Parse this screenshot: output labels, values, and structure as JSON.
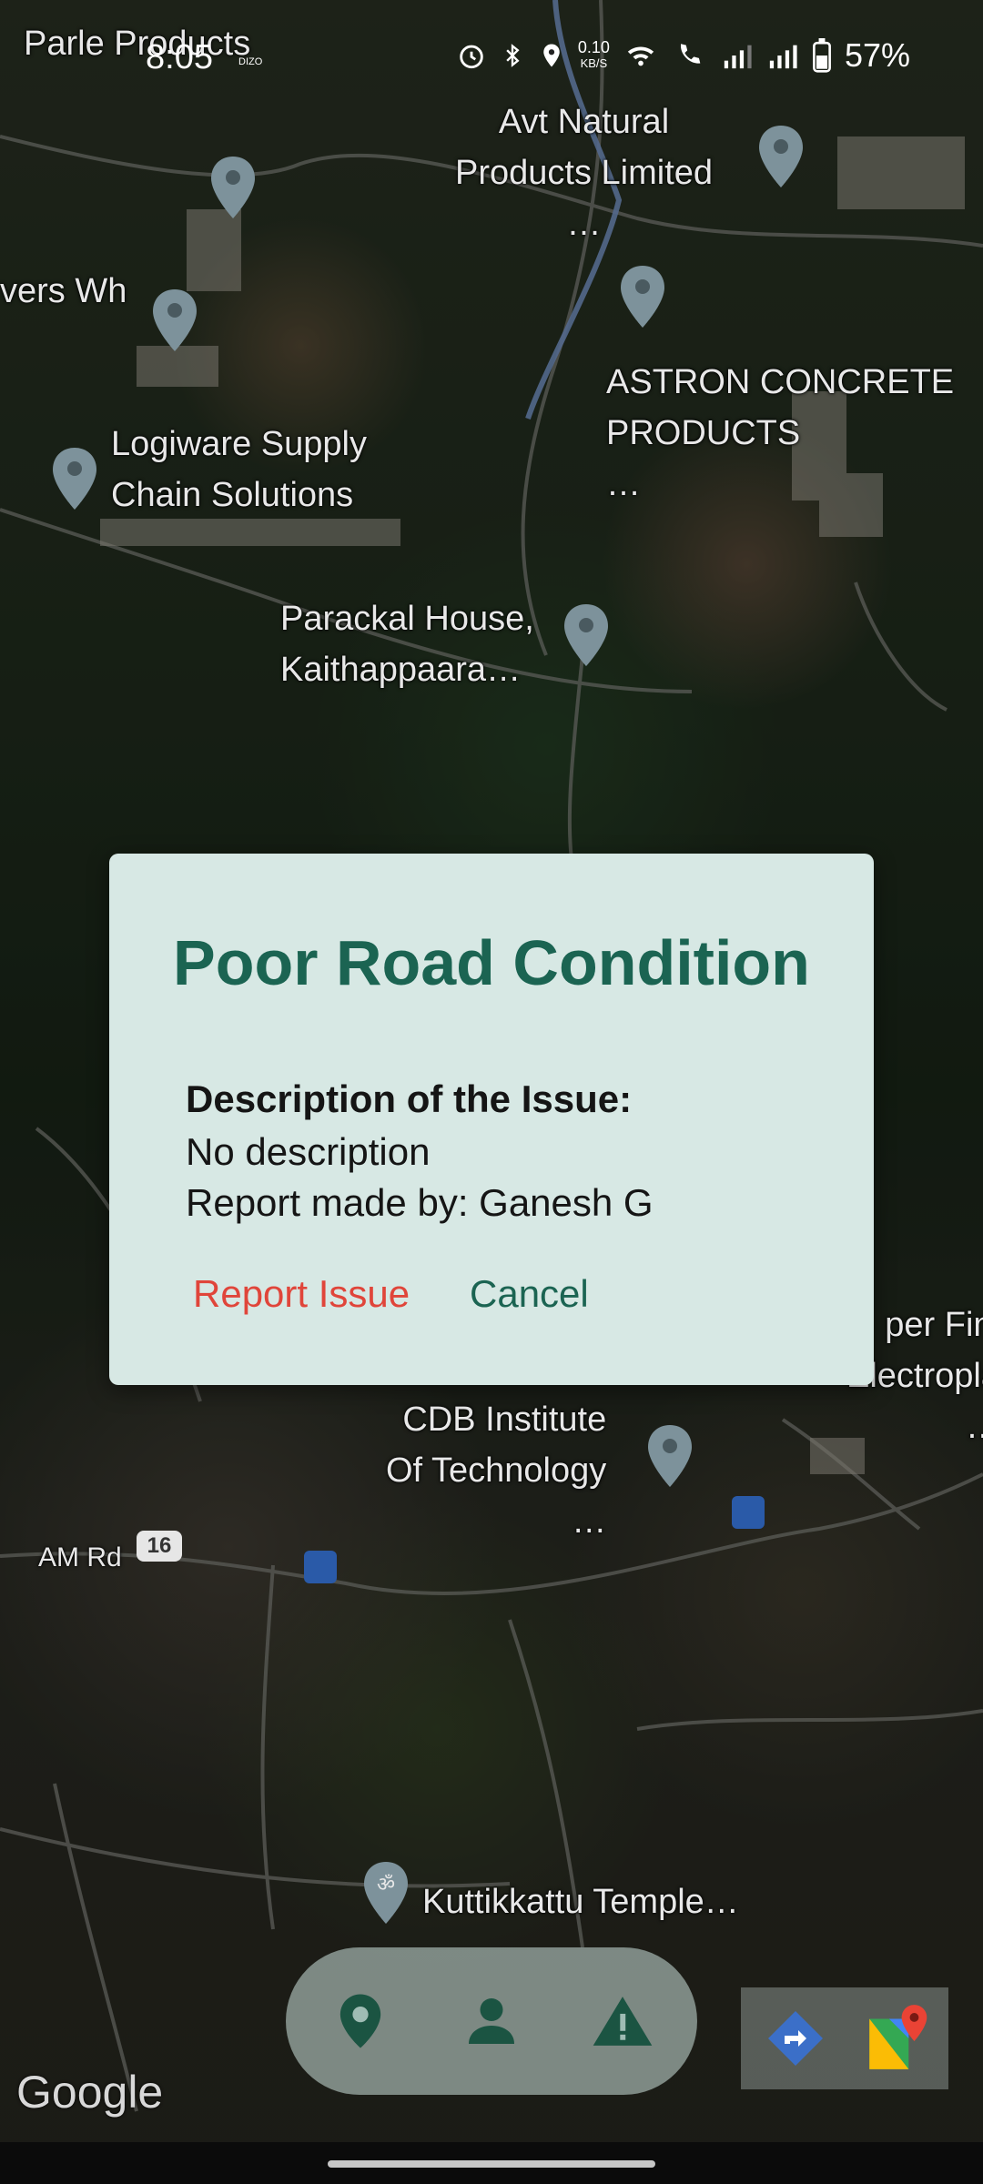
{
  "status_bar": {
    "time": "8:05",
    "brand": "DIZO",
    "net_speed_value": "0.10",
    "net_speed_unit": "KB/S",
    "battery": "57%",
    "icons": [
      "alarm-icon",
      "bluetooth-icon",
      "location-icon",
      "wifi-icon",
      "wifi-call-icon",
      "signal-icon",
      "signal-icon",
      "battery-icon"
    ]
  },
  "map": {
    "places": [
      {
        "name": "Parle Products"
      },
      {
        "name": "Avt Natural\nProducts Limited\n…"
      },
      {
        "name": "vers Wh"
      },
      {
        "name": "ASTRON CONCRETE\nPRODUCTS\n…"
      },
      {
        "name": "Logiware Supply\nChain Solutions"
      },
      {
        "name": "Parackal House,\nKaithappaara…"
      },
      {
        "name": "CDB Institute\nOf Technology\n…"
      },
      {
        "name": "per Fini\nElectropla\n…"
      },
      {
        "name": "Kuttikkattu Temple…"
      },
      {
        "name": "AM Rd"
      }
    ],
    "road_shield": "16",
    "attribution": "Google"
  },
  "dialog": {
    "title": "Poor Road Condition",
    "description_heading": "Description of the Issue:",
    "description": "No description",
    "reporter": "Report made by: Ganesh G",
    "report_button": "Report Issue",
    "cancel_button": "Cancel",
    "colors": {
      "title": "#1b6452",
      "report": "#e0453a",
      "cancel": "#1b6452",
      "background": "#d7e8e4"
    }
  },
  "bottom_nav": {
    "items": [
      {
        "icon": "location-pin-icon"
      },
      {
        "icon": "person-icon"
      },
      {
        "icon": "warning-icon"
      }
    ],
    "accent": "#1b5442"
  },
  "map_tools": [
    {
      "icon": "directions-icon"
    },
    {
      "icon": "google-maps-icon"
    }
  ]
}
